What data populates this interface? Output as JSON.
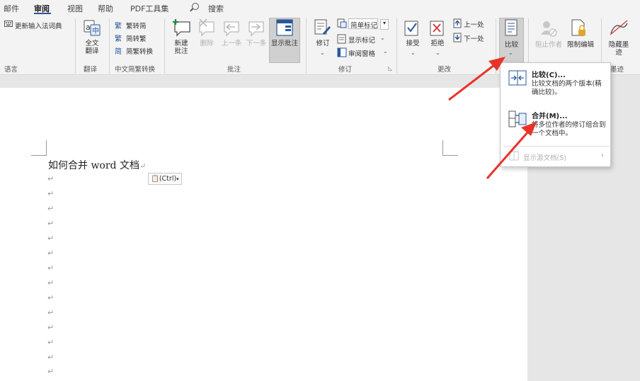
{
  "tabs": [
    {
      "label": "邮件",
      "active": false
    },
    {
      "label": "审阅",
      "active": true
    },
    {
      "label": "视图",
      "active": false
    },
    {
      "label": "帮助",
      "active": false
    },
    {
      "label": "PDF工具集",
      "active": false
    },
    {
      "label": "搜索",
      "active": false
    }
  ],
  "ribbon": {
    "language": {
      "update_ime_label": "更新输入法词典",
      "group_label": "语言"
    },
    "translate": {
      "full_text_label": "全文\n翻译",
      "group_label": "翻译"
    },
    "chinese_conversion": {
      "trad_to_simp": "繁转简",
      "simp_to_trad": "简转繁",
      "conversion": "简繁转换",
      "group_label": "中文简繁转换"
    },
    "comments": {
      "new_comment": "新建\n批注",
      "delete": "删除",
      "previous": "上一条",
      "next": "下一条",
      "show_comments": "显示批注",
      "group_label": "批注"
    },
    "tracking": {
      "track_changes": "修订",
      "markup_select": "简单标记",
      "show_markup": "显示标记",
      "reviewing_pane": "审阅窗格",
      "group_label": "修订"
    },
    "changes": {
      "accept": "接受",
      "reject": "拒绝",
      "previous": "上一处",
      "next": "下一处",
      "group_label": "更改"
    },
    "compare": {
      "label": "比较"
    },
    "protect": {
      "block_authors": "阻止作者",
      "restrict_editing": "限制编辑"
    },
    "ink": {
      "hide_ink": "隐藏墨\n迹",
      "group_label": "墨迹"
    }
  },
  "document": {
    "title_text": "如何合并 word 文档",
    "paragraph_mark": "↵",
    "paste_options_label": "(Ctrl)"
  },
  "compare_dropdown": {
    "compare_title": "比较(C)...",
    "compare_desc": "比较文档的两个版本(精确比较)。",
    "combine_title": "合并(M)...",
    "combine_desc": "将多位作者的修订组合到一个文档中。",
    "show_source": "显示源文档(S)"
  },
  "colors": {
    "accent": "#2b579a",
    "arrow": "#e8332a",
    "ribbon_bg": "#f3f3f3"
  }
}
